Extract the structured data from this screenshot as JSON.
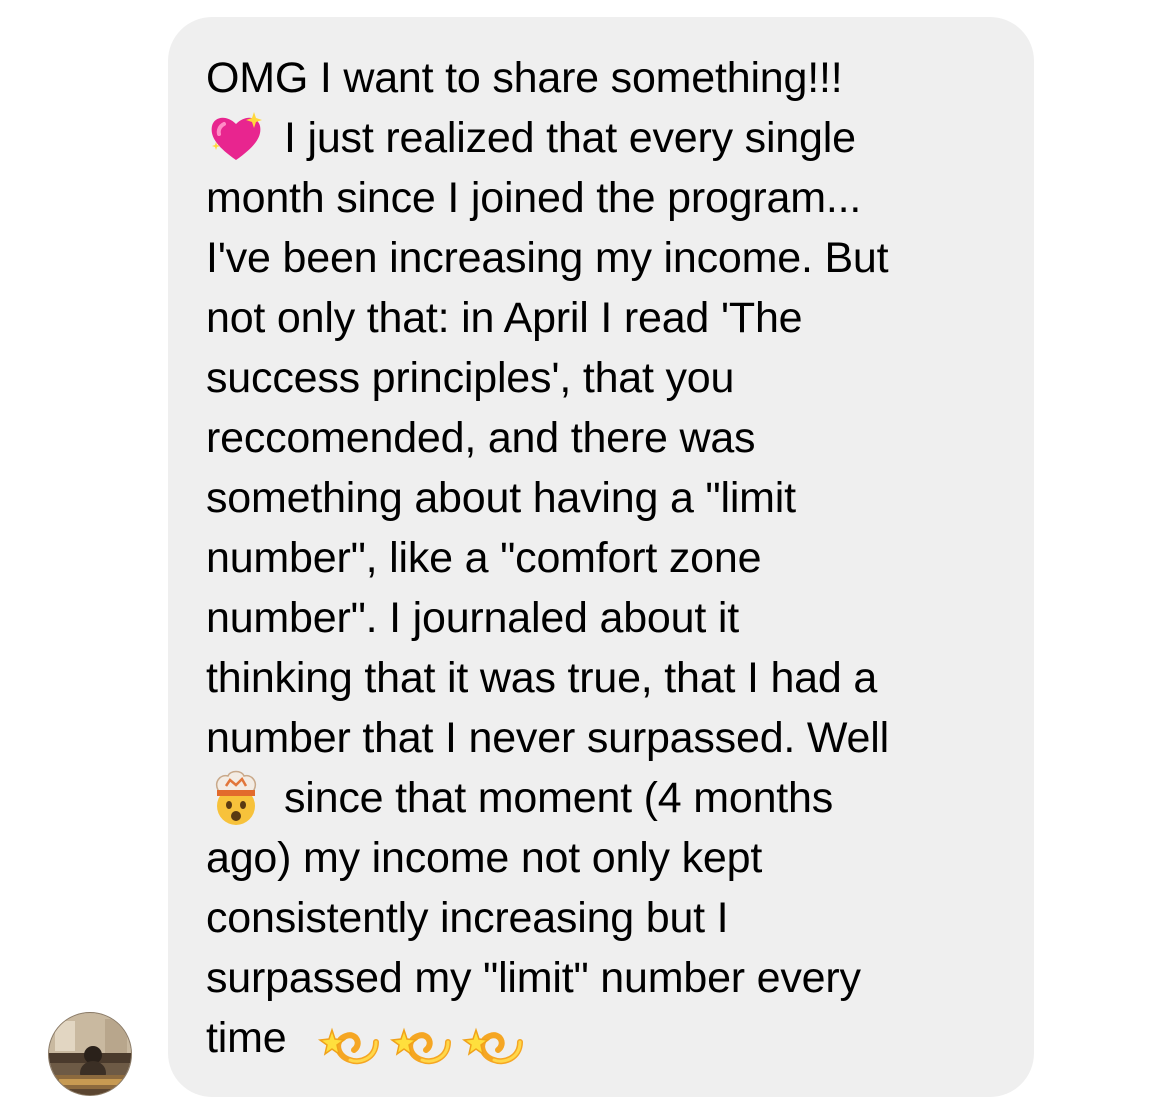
{
  "message": {
    "lines": [
      "OMG I want to share something!!!",
      "I just realized that every single",
      "month since I joined the program...",
      "I've been increasing my income. But",
      "not only that: in April I read 'The",
      "success principles', that you",
      "reccomended, and there was",
      "something about having a \"limit",
      "number\", like a \"comfort zone",
      "number\". I journaled about it",
      "thinking that it was true, that I had a",
      "number that I never surpassed. Well",
      "since that moment (4 months",
      "ago) my income not only kept",
      "consistently increasing but I",
      "surpassed my \"limit\" number every",
      "time"
    ],
    "emojis": {
      "line_2_leading": "sparkling-heart-icon",
      "line_13_leading": "exploding-head-icon",
      "line_17_trailing": [
        "dizzy-icon",
        "dizzy-icon",
        "dizzy-icon"
      ]
    }
  },
  "sender": {
    "avatar": "avatar"
  },
  "colors": {
    "bubble": "#efefef",
    "text": "#000000",
    "background": "#ffffff"
  }
}
